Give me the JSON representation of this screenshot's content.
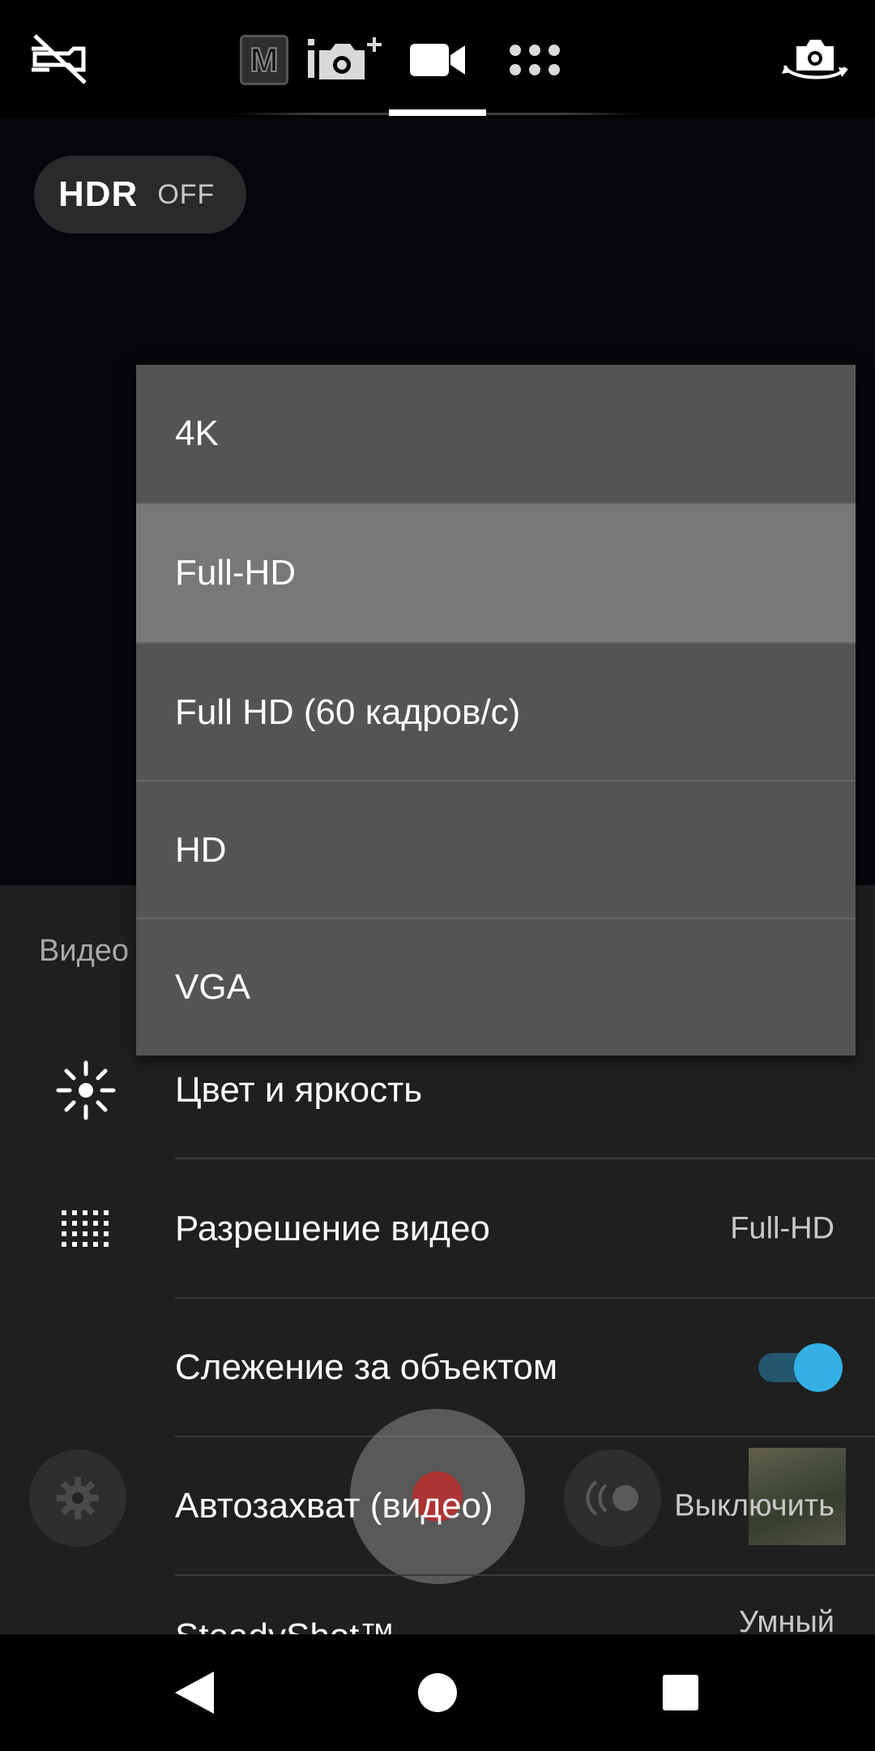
{
  "top_bar": {
    "icons": [
      "flash-off-icon",
      "manual-mode-icon",
      "photo-plus-mode-icon",
      "video-mode-icon",
      "more-modes-icon",
      "switch-camera-icon"
    ],
    "manual_mode_letter": "M",
    "active_mode": "video"
  },
  "hdr": {
    "label": "HDR",
    "state": "OFF"
  },
  "panel": {
    "section_title": "Видео",
    "rows": [
      {
        "icon": "brightness-icon",
        "label": "Цвет и яркость",
        "value": ""
      },
      {
        "icon": "resolution-grid-icon",
        "label": "Разрешение видео",
        "value": "Full-HD"
      },
      {
        "icon": "",
        "label": "Слежение за объектом",
        "value": "",
        "toggle_on": true
      },
      {
        "icon": "",
        "label": "Автозахват (видео)",
        "value": "Выключить"
      },
      {
        "icon": "",
        "label": "SteadyShot™",
        "value": "Умный"
      }
    ]
  },
  "dropdown": {
    "options": [
      "4K",
      "Full-HD",
      "Full HD (60 кадров/с)",
      "HD",
      "VGA"
    ],
    "selected": "Full-HD"
  },
  "controls": {
    "icons": [
      "settings-gear-icon",
      "record-icon",
      "live-stream-icon"
    ]
  },
  "navbar": {
    "icons": [
      "back-icon",
      "home-icon",
      "recents-icon"
    ]
  },
  "colors": {
    "accent": "#34b0e6",
    "toggle_track": "#23556c",
    "panel_bg": "#1f1f1f",
    "dropdown_bg": "#545454",
    "dropdown_selected": "#787878"
  }
}
